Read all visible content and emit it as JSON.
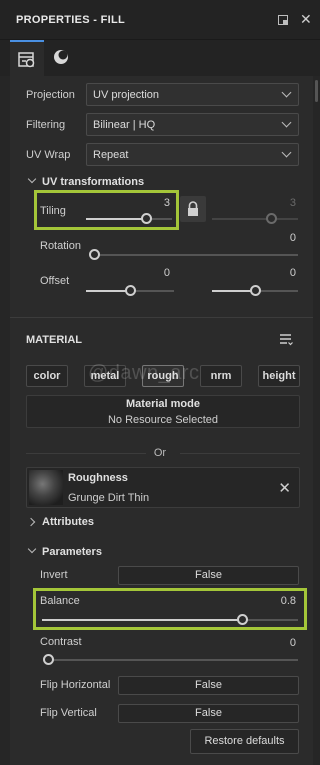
{
  "panel": {
    "title": "PROPERTIES - FILL",
    "float_icon": "float-window-icon",
    "close_icon": "close-icon",
    "close_glyph": "✕"
  },
  "tabs": [
    {
      "name": "fill-properties-tab",
      "icon": "fill-settings-icon",
      "active": true
    },
    {
      "name": "material-preview-tab",
      "icon": "sphere-icon",
      "active": false
    }
  ],
  "projection": {
    "label": "Projection",
    "value": "UV projection"
  },
  "filtering": {
    "label": "Filtering",
    "value": "Bilinear | HQ"
  },
  "uv_wrap": {
    "label": "UV Wrap",
    "value": "Repeat"
  },
  "uv_transformations": {
    "header": "UV transformations",
    "tiling": {
      "label": "Tiling",
      "value": "3",
      "value_linked": "3",
      "level": 0.6
    },
    "rotation": {
      "label": "Rotation",
      "value": "0"
    },
    "offset": {
      "label": "Offset",
      "value_u": "0",
      "value_v": "0"
    }
  },
  "material": {
    "header": "MATERIAL",
    "menu_icon": "list-menu-icon",
    "channels": [
      "color",
      "metal",
      "rough",
      "nrm",
      "height"
    ],
    "active_channel": "rough",
    "watermark": "@dawn_arc",
    "mode_title": "Material mode",
    "mode_subtitle": "No Resource Selected"
  },
  "or_text": "Or",
  "resource": {
    "name": "Roughness",
    "subtitle": "Grunge Dirt Thin",
    "remove_glyph": "✕"
  },
  "attributes": {
    "header": "Attributes"
  },
  "parameters": {
    "header": "Parameters",
    "invert": {
      "label": "Invert",
      "value": "False"
    },
    "balance": {
      "label": "Balance",
      "value": "0.8",
      "level": 0.8
    },
    "contrast": {
      "label": "Contrast",
      "value": "0",
      "level": 0
    },
    "flip_horizontal": {
      "label": "Flip Horizontal",
      "value": "False"
    },
    "flip_vertical": {
      "label": "Flip Vertical",
      "value": "False"
    }
  },
  "restore_label": "Restore defaults",
  "colors": {
    "highlight": "#a4c639",
    "active_tab": "#4a90e2",
    "background": "#2b2b2b"
  }
}
